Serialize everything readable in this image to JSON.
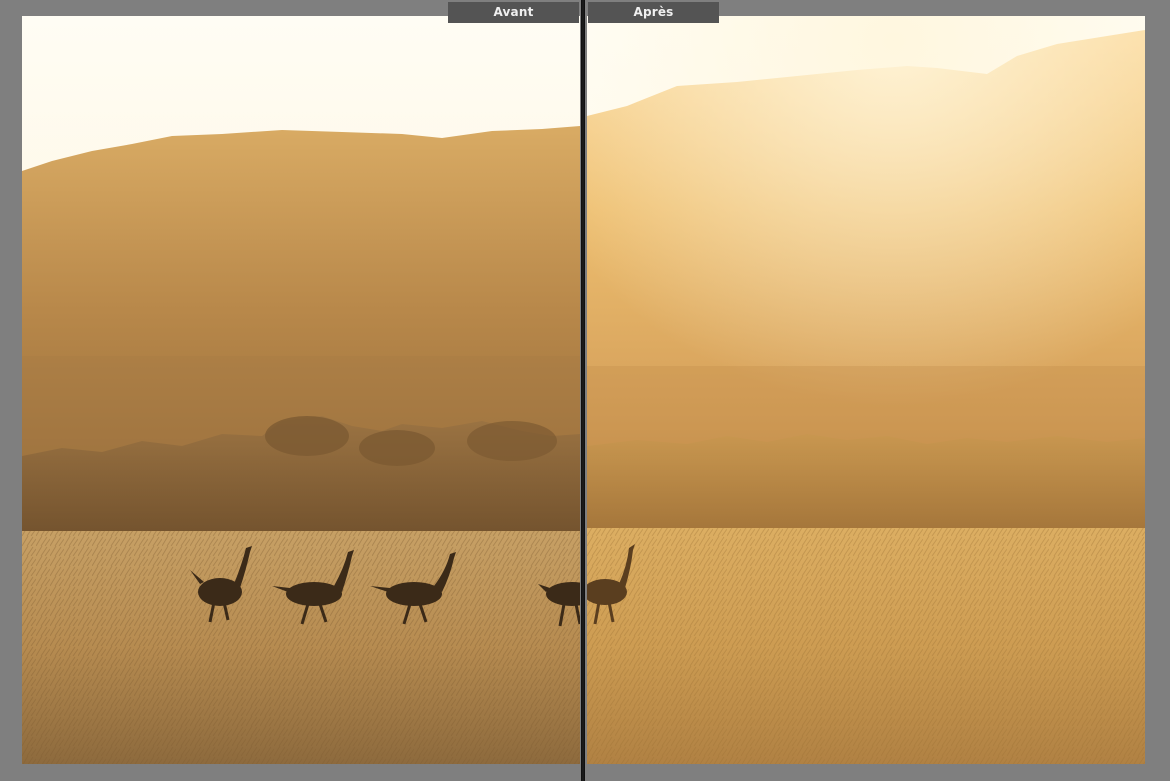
{
  "compare": {
    "before_label": "Avant",
    "after_label": "Après"
  },
  "photo": {
    "subject": "ostrich-silhouettes-savanna",
    "before_ostrich_count": 4,
    "after_ostrich_count": 1
  },
  "colors": {
    "app_background": "#7f7f7f",
    "tab_background": "#545454",
    "tab_text": "#f0f0f0",
    "divider": "#101010"
  }
}
